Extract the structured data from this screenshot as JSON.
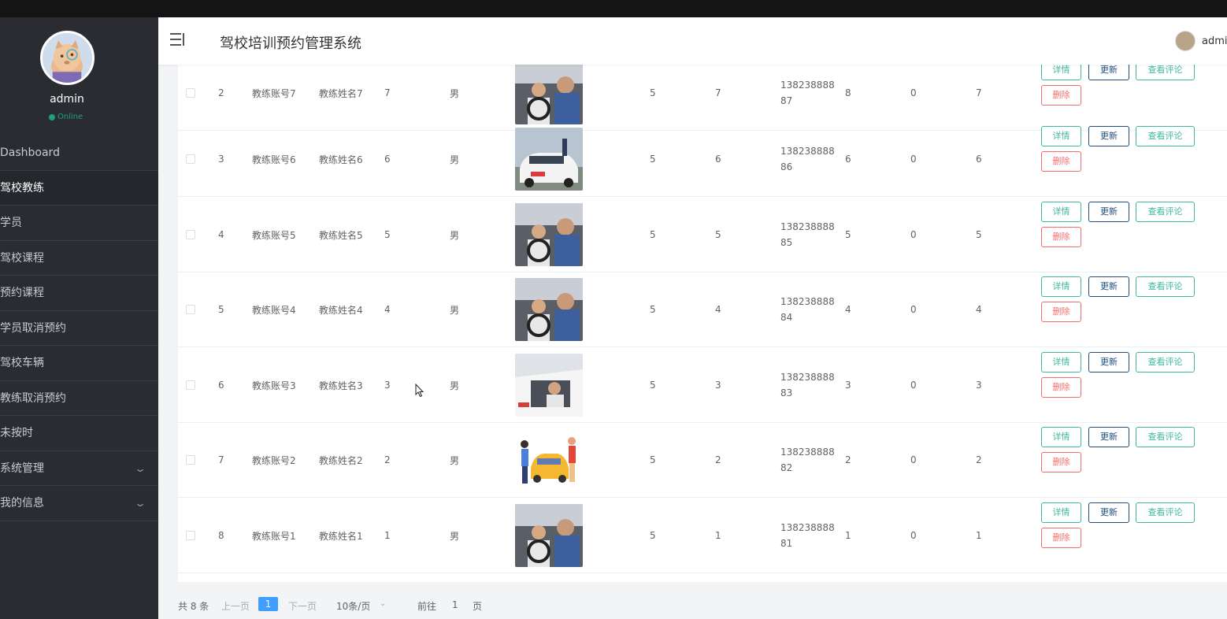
{
  "app": {
    "title": "驾校培训预约管理系统",
    "user": "admin"
  },
  "profile": {
    "name": "admin",
    "status": "Online"
  },
  "sidebar": {
    "items": [
      {
        "label": "Dashboard"
      },
      {
        "label": "驾校教练"
      },
      {
        "label": "学员"
      },
      {
        "label": "驾校课程"
      },
      {
        "label": "预约课程"
      },
      {
        "label": "学员取消预约"
      },
      {
        "label": "驾校车辆"
      },
      {
        "label": "教练取消预约"
      },
      {
        "label": "未按时"
      },
      {
        "label": "系统管理"
      },
      {
        "label": "我的信息"
      }
    ]
  },
  "actions": {
    "detail": "详情",
    "update": "更新",
    "review": "查看评论",
    "delete": "删除"
  },
  "rows": [
    {
      "idx": "2",
      "account": "教练账号7",
      "name": "教练姓名7",
      "age": "7",
      "gender": "男",
      "c1": "5",
      "c2": "7",
      "phone1": "138238888",
      "phone2": "87",
      "c3": "8",
      "c4": "0",
      "c5": "7",
      "photo": "driver-lesson-interior"
    },
    {
      "idx": "3",
      "account": "教练账号6",
      "name": "教练姓名6",
      "age": "6",
      "gender": "男",
      "c1": "5",
      "c2": "6",
      "phone1": "138238888",
      "phone2": "86",
      "c3": "6",
      "c4": "0",
      "c5": "6",
      "photo": "training-car-exterior"
    },
    {
      "idx": "4",
      "account": "教练账号5",
      "name": "教练姓名5",
      "age": "5",
      "gender": "男",
      "c1": "5",
      "c2": "5",
      "phone1": "138238888",
      "phone2": "85",
      "c3": "5",
      "c4": "0",
      "c5": "5",
      "photo": "driver-lesson-interior"
    },
    {
      "idx": "5",
      "account": "教练账号4",
      "name": "教练姓名4",
      "age": "4",
      "gender": "男",
      "c1": "5",
      "c2": "4",
      "phone1": "138238888",
      "phone2": "84",
      "c3": "4",
      "c4": "0",
      "c5": "4",
      "photo": "driver-lesson-interior"
    },
    {
      "idx": "6",
      "account": "教练账号3",
      "name": "教练姓名3",
      "age": "3",
      "gender": "男",
      "c1": "5",
      "c2": "3",
      "phone1": "138238888",
      "phone2": "83",
      "c3": "3",
      "c4": "0",
      "c5": "3",
      "photo": "driver-through-window"
    },
    {
      "idx": "7",
      "account": "教练账号2",
      "name": "教练姓名2",
      "age": "2",
      "gender": "男",
      "c1": "5",
      "c2": "2",
      "phone1": "138238888",
      "phone2": "82",
      "c3": "2",
      "c4": "0",
      "c5": "2",
      "photo": "cartoon-car-people"
    },
    {
      "idx": "8",
      "account": "教练账号1",
      "name": "教练姓名1",
      "age": "1",
      "gender": "男",
      "c1": "5",
      "c2": "1",
      "phone1": "138238888",
      "phone2": "81",
      "c3": "1",
      "c4": "0",
      "c5": "1",
      "photo": "driver-lesson-interior"
    }
  ],
  "pagination": {
    "total": "共 8 条",
    "prev": "上一页",
    "current": "1",
    "next": "下一页",
    "page_size": "10条/页",
    "goto": "前往",
    "goto_value": "1",
    "page_suffix": "页"
  },
  "colors": {
    "sidebar_bg": "#2a2c31",
    "detail": "#3fb89d",
    "update": "#1f4e7a",
    "delete": "#f56c6c",
    "page_active": "#409eff"
  }
}
